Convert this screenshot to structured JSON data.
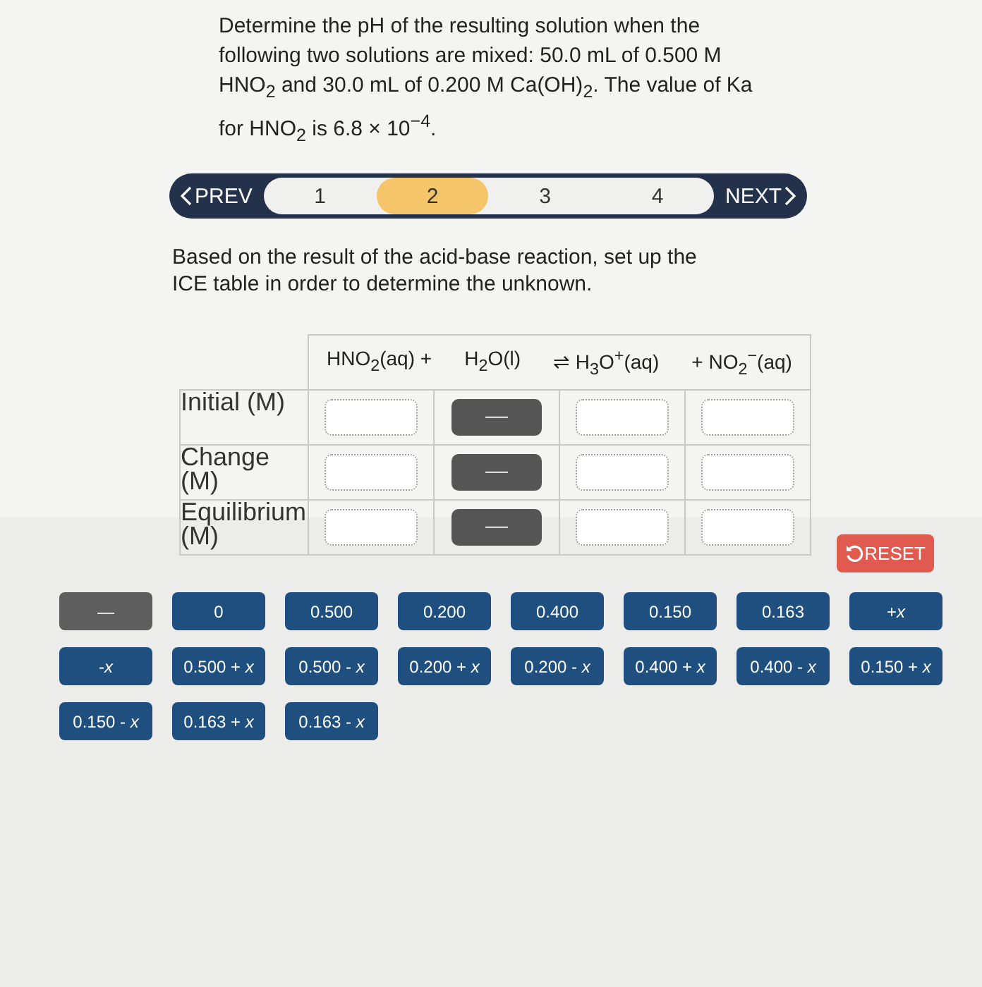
{
  "question": "Determine the pH of the resulting solution when the following two solutions are mixed: 50.0 mL of 0.500 M HNO$_{2}$ and 30.0 mL of 0.200 M Ca(OH)$_{2}$. The value of Ka for HNO$_{2}$ is 6.8 × 10$^{−4}$.",
  "stepper": {
    "prev": "PREV",
    "next": "NEXT",
    "steps": [
      {
        "label": "1",
        "selected": false
      },
      {
        "label": "2",
        "selected": true
      },
      {
        "label": "3",
        "selected": false
      },
      {
        "label": "4",
        "selected": false
      }
    ]
  },
  "instruction": "Based on the result of the acid-base reaction, set up the ICE table in order to determine the unknown.",
  "ice_table": {
    "header": [
      "HNO$_{2}$(aq) +",
      "H$_{2}$O(l)",
      "⇌ H$_{3}$O$^{+}$(aq)",
      "+ NO$_{2}$$^{−}$(aq)"
    ],
    "rows": [
      {
        "label": "Initial (M)",
        "cells": [
          {
            "kind": "empty"
          },
          {
            "kind": "dash",
            "text": "—"
          },
          {
            "kind": "empty"
          },
          {
            "kind": "empty"
          }
        ]
      },
      {
        "label": "Change (M)",
        "cells": [
          {
            "kind": "empty"
          },
          {
            "kind": "dash",
            "text": "—"
          },
          {
            "kind": "empty"
          },
          {
            "kind": "empty"
          }
        ]
      },
      {
        "label": "Equilibrium (M)",
        "cells": [
          {
            "kind": "empty"
          },
          {
            "kind": "dash",
            "text": "—"
          },
          {
            "kind": "empty"
          },
          {
            "kind": "empty"
          }
        ]
      }
    ]
  },
  "reset": "RESET",
  "tiles": [
    {
      "text": "—",
      "kind": "dash"
    },
    {
      "text": "0",
      "kind": "value"
    },
    {
      "text": "0.500",
      "kind": "value"
    },
    {
      "text": "0.200",
      "kind": "value"
    },
    {
      "text": "0.400",
      "kind": "value"
    },
    {
      "text": "0.150",
      "kind": "value"
    },
    {
      "text": "0.163",
      "kind": "value"
    },
    {
      "text": "+*x*",
      "kind": "value"
    },
    {
      "text": "-*x*",
      "kind": "value"
    },
    {
      "text": "0.500 + *x*",
      "kind": "value"
    },
    {
      "text": "0.500 - *x*",
      "kind": "value"
    },
    {
      "text": "0.200 + *x*",
      "kind": "value"
    },
    {
      "text": "0.200 - *x*",
      "kind": "value"
    },
    {
      "text": "0.400 + *x*",
      "kind": "value"
    },
    {
      "text": "0.400 - *x*",
      "kind": "value"
    },
    {
      "text": "0.150 + *x*",
      "kind": "value"
    },
    {
      "text": "0.150 - *x*",
      "kind": "value"
    },
    {
      "text": "0.163 + *x*",
      "kind": "value"
    },
    {
      "text": "0.163 - *x*",
      "kind": "value"
    }
  ]
}
